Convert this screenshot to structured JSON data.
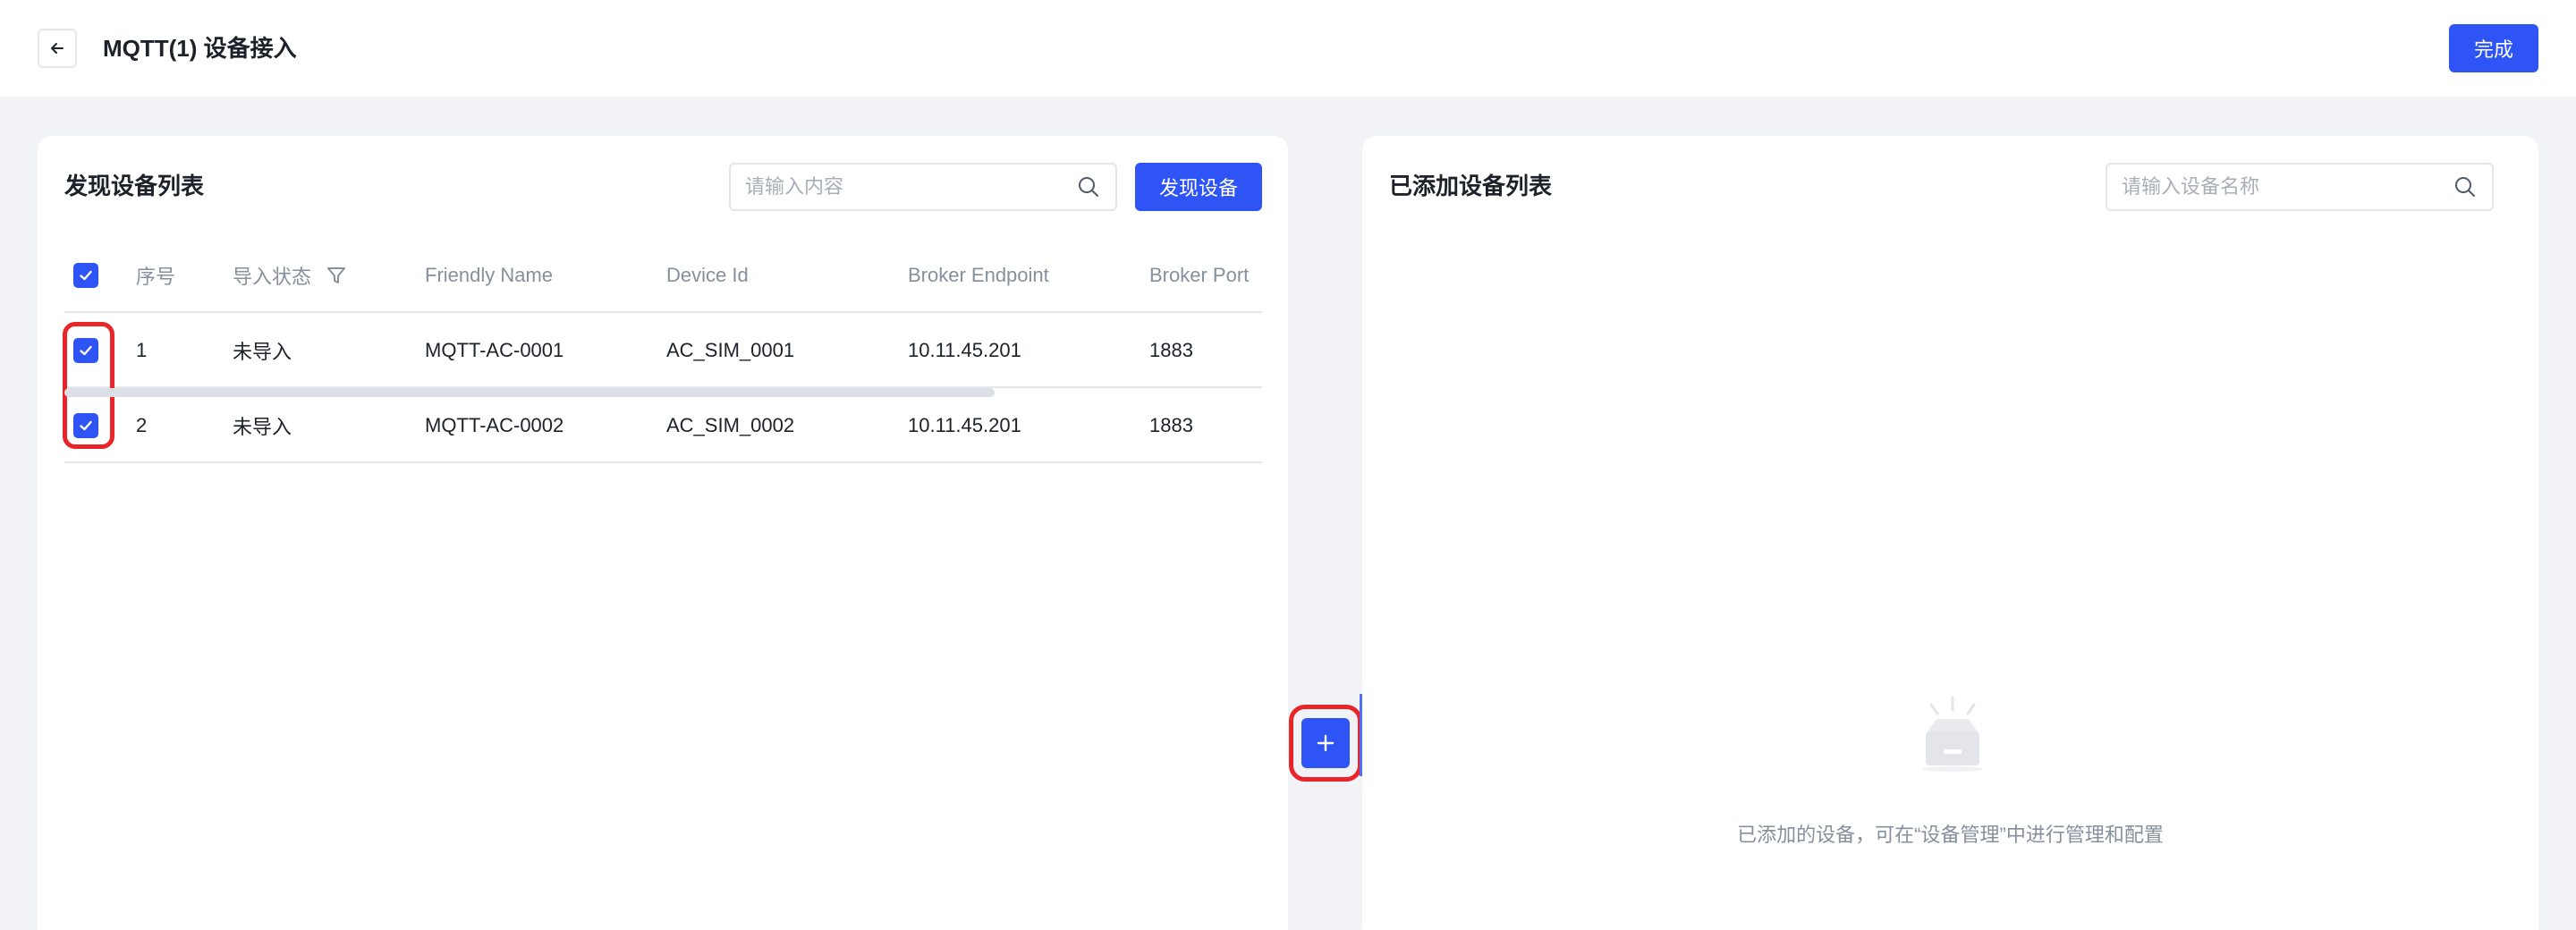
{
  "header": {
    "title": "MQTT(1) 设备接入",
    "done_label": "完成"
  },
  "left_panel": {
    "title": "发现设备列表",
    "search_placeholder": "请输入内容",
    "discover_label": "发现设备",
    "columns": [
      "序号",
      "导入状态",
      "Friendly Name",
      "Device Id",
      "Broker Endpoint",
      "Broker Port"
    ],
    "rows": [
      {
        "index": "1",
        "status": "未导入",
        "friendly_name": "MQTT-AC-0001",
        "device_id": "AC_SIM_0001",
        "broker_endpoint": "10.11.45.201",
        "broker_port": "1883"
      },
      {
        "index": "2",
        "status": "未导入",
        "friendly_name": "MQTT-AC-0002",
        "device_id": "AC_SIM_0002",
        "broker_endpoint": "10.11.45.201",
        "broker_port": "1883"
      }
    ]
  },
  "right_panel": {
    "title": "已添加设备列表",
    "search_placeholder": "请输入设备名称",
    "empty_text": "已添加的设备，可在“设备管理”中进行管理和配置"
  },
  "colors": {
    "primary": "#2e54f5",
    "highlight": "#e8262a",
    "background": "#f2f3f7"
  },
  "icons": {
    "back": "arrow-left-icon",
    "search": "search-icon",
    "filter": "filter-icon",
    "check": "check-icon",
    "add": "plus-icon",
    "empty": "empty-box-icon"
  }
}
